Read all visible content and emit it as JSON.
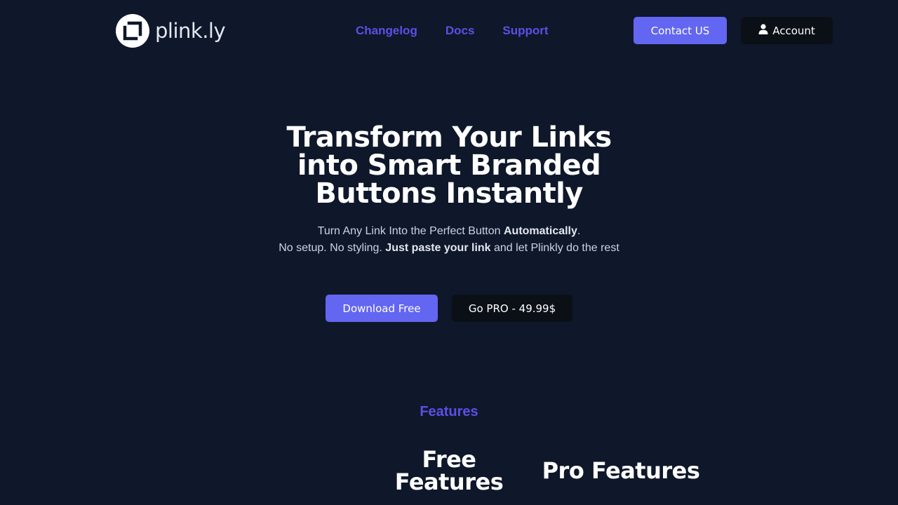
{
  "header": {
    "logo_text": "plink.ly",
    "nav": [
      {
        "label": "Changelog"
      },
      {
        "label": "Docs"
      },
      {
        "label": "Support"
      }
    ],
    "contact_label": "Contact US",
    "account_label": "Account"
  },
  "hero": {
    "title": "Transform Your Links into Smart Branded Buttons Instantly",
    "sub_line1_pre": "Turn Any Link Into the Perfect Button ",
    "sub_line1_bold": "Automatically",
    "sub_line1_post": ".",
    "sub_line2_pre": "No setup. No styling. ",
    "sub_line2_bold": "Just paste your link",
    "sub_line2_post": " and let Plinkly do the rest",
    "download_label": "Download Free",
    "pro_label": "Go PRO - 49.99$"
  },
  "features": {
    "eyebrow": "Features",
    "free_heading": "Free Features",
    "pro_heading": "Pro Features"
  },
  "colors": {
    "background": "#0f172a",
    "accent": "#6366f1",
    "nav_link": "#5b50e6",
    "dark_button": "#0b1017"
  },
  "icons": {
    "logo": "square-bracket-logo-icon",
    "account": "user-icon"
  }
}
